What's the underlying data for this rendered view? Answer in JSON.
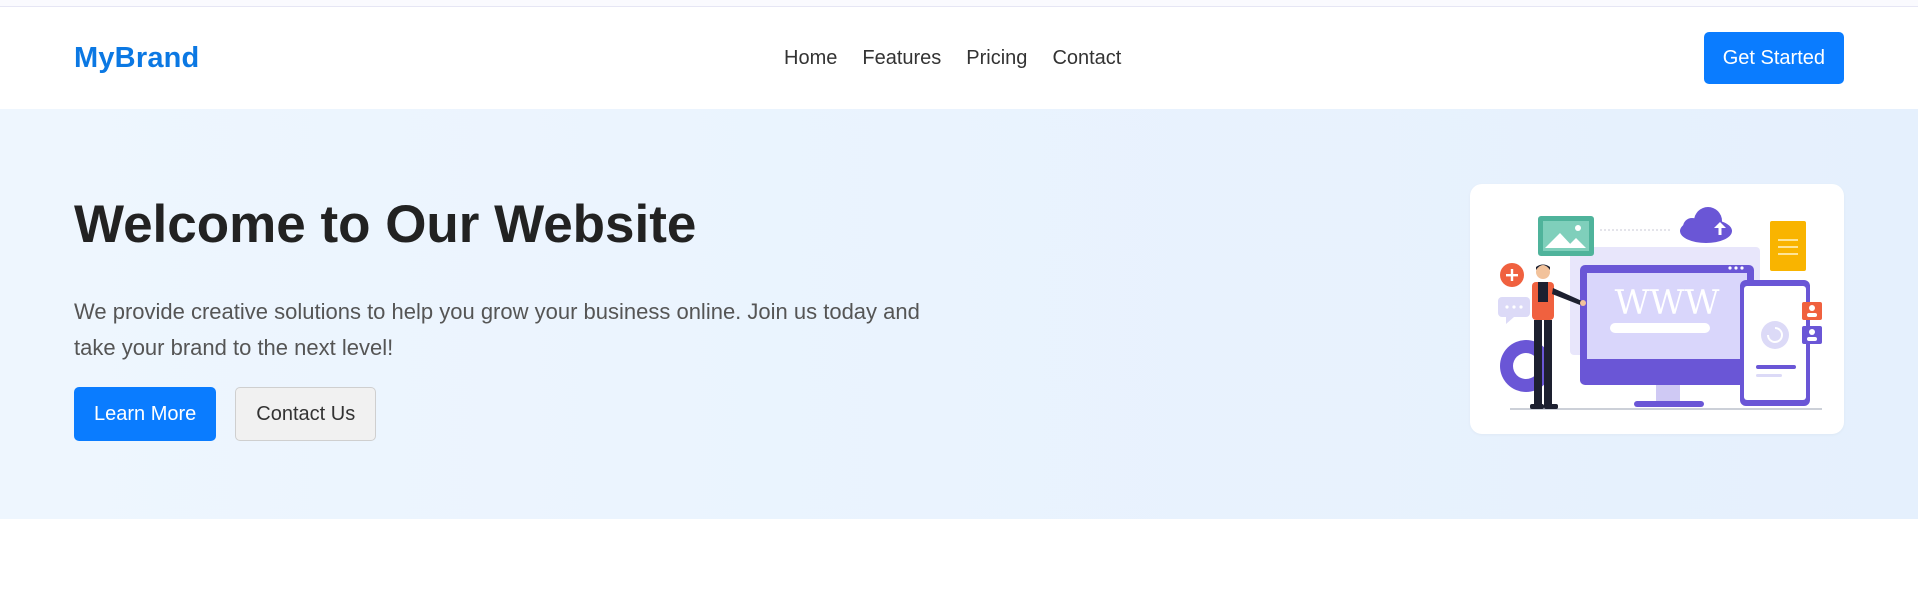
{
  "header": {
    "brand": "MyBrand",
    "nav": [
      "Home",
      "Features",
      "Pricing",
      "Contact"
    ],
    "cta_label": "Get Started"
  },
  "hero": {
    "title": "Welcome to Our Website",
    "description": "We provide creative solutions to help you grow your business online. Join us today and take your brand to the next level!",
    "primary_button": "Learn More",
    "secondary_button": "Contact Us",
    "illustration": {
      "screen_text": "WWW",
      "icons": [
        "image-icon",
        "cloud-upload-icon",
        "document-icon",
        "plus-icon",
        "chat-icon",
        "gear-icon",
        "user-icon",
        "refresh-icon"
      ]
    }
  },
  "colors": {
    "brand": "#0b78e3",
    "primary_button": "#0a7cff",
    "hero_background": "#e8f2fd",
    "illustration_accent": "#6a56d6"
  }
}
